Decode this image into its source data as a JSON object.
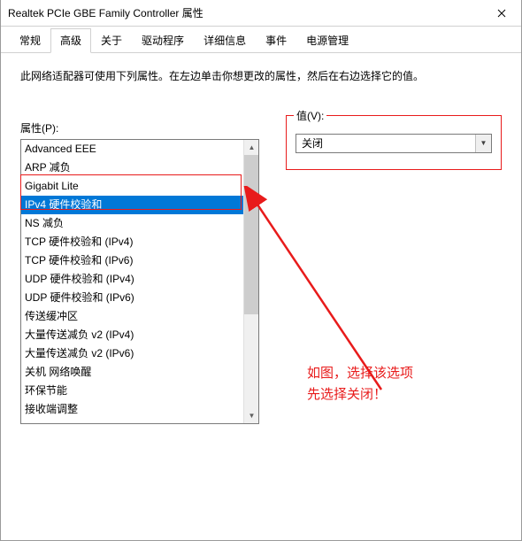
{
  "window": {
    "title": "Realtek PCIe GBE Family Controller 属性"
  },
  "tabs": {
    "items": [
      "常规",
      "高级",
      "关于",
      "驱动程序",
      "详细信息",
      "事件",
      "电源管理"
    ],
    "active_index": 1
  },
  "description": "此网络适配器可使用下列属性。在左边单击你想更改的属性，然后在右边选择它的值。",
  "property_label": "属性(P):",
  "value_label": "值(V):",
  "properties": {
    "items": [
      "Advanced EEE",
      "ARP 减负",
      "Gigabit Lite",
      "IPv4 硬件校验和",
      "NS 减负",
      "TCP 硬件校验和 (IPv4)",
      "TCP 硬件校验和 (IPv6)",
      "UDP 硬件校验和 (IPv4)",
      "UDP 硬件校验和 (IPv6)",
      "传送缓冲区",
      "大量传送减负 v2 (IPv4)",
      "大量传送减负 v2 (IPv6)",
      "关机 网络唤醒",
      "环保节能",
      "接收端调整"
    ],
    "selected_index": 3
  },
  "value_select": {
    "value": "关闭"
  },
  "annotation": {
    "line1": "如图，选择该选项",
    "line2": "先选择关闭！"
  }
}
